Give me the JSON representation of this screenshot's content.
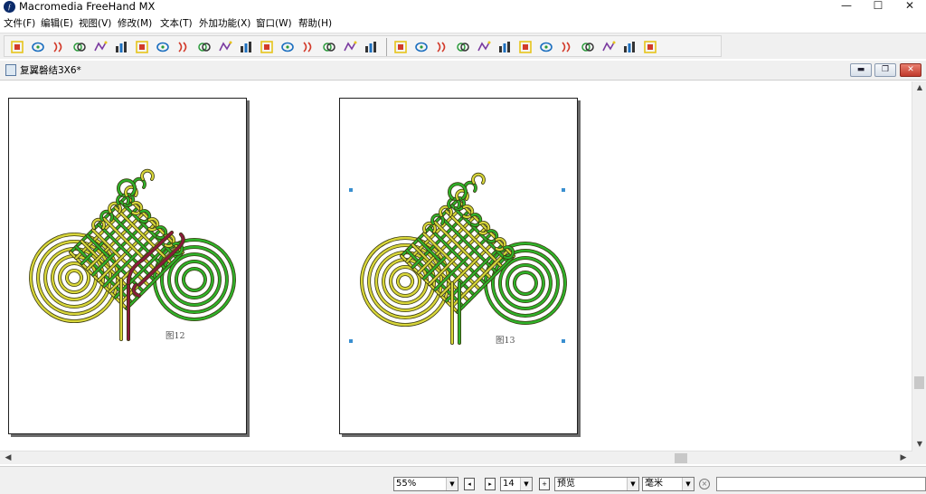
{
  "app": {
    "title": "Macromedia FreeHand MX",
    "icon": "freehand-app-icon"
  },
  "window_controls": {
    "minimize": "—",
    "maximize": "☐",
    "close": "✕"
  },
  "menu": [
    "文件(F)",
    "编辑(E)",
    "视图(V)",
    "修改(M)",
    "文本(T)",
    "外加功能(X)",
    "窗口(W)",
    "帮助(H)"
  ],
  "toolbar": {
    "icons": [
      "arrange-icon",
      "square-frame-icon",
      "blend-icon",
      "ellipse-icon",
      "union-icon",
      "intersect-icon",
      "punch-icon",
      "crop-icon",
      "transparency-icon",
      "split-icon",
      "spiral-blend-icon",
      "reflect-icon",
      "fisheye-icon",
      "color-swatch-icon",
      "wave-icon",
      "table-icon",
      "corner-icon",
      "sine-icon",
      "graph-icon",
      "eyedropper-icon",
      "arc-icon",
      "spiral-icon",
      "mirror-icon",
      "envelope-icon",
      "fill-icon",
      "extrude-icon",
      "shadow-icon",
      "layers-icon",
      "funnel-icon",
      "scatter-icon",
      "3d-rotate-icon"
    ]
  },
  "document": {
    "title": "复翼磬结3X6*",
    "controls": {
      "minimize": "▬",
      "restore": "❐",
      "close": "✕"
    },
    "pages": [
      {
        "label": "图12",
        "selected": false
      },
      {
        "label": "图13",
        "selected": true
      }
    ]
  },
  "status": {
    "zoom": "55%",
    "page_number": "14",
    "view_mode": "预览",
    "units": "毫米",
    "message": ""
  },
  "colors": {
    "knot_yellow": "#d8d63a",
    "knot_green": "#2fb22a",
    "knot_maroon": "#8b1a3c",
    "selection_handle": "#3a8fd0"
  }
}
